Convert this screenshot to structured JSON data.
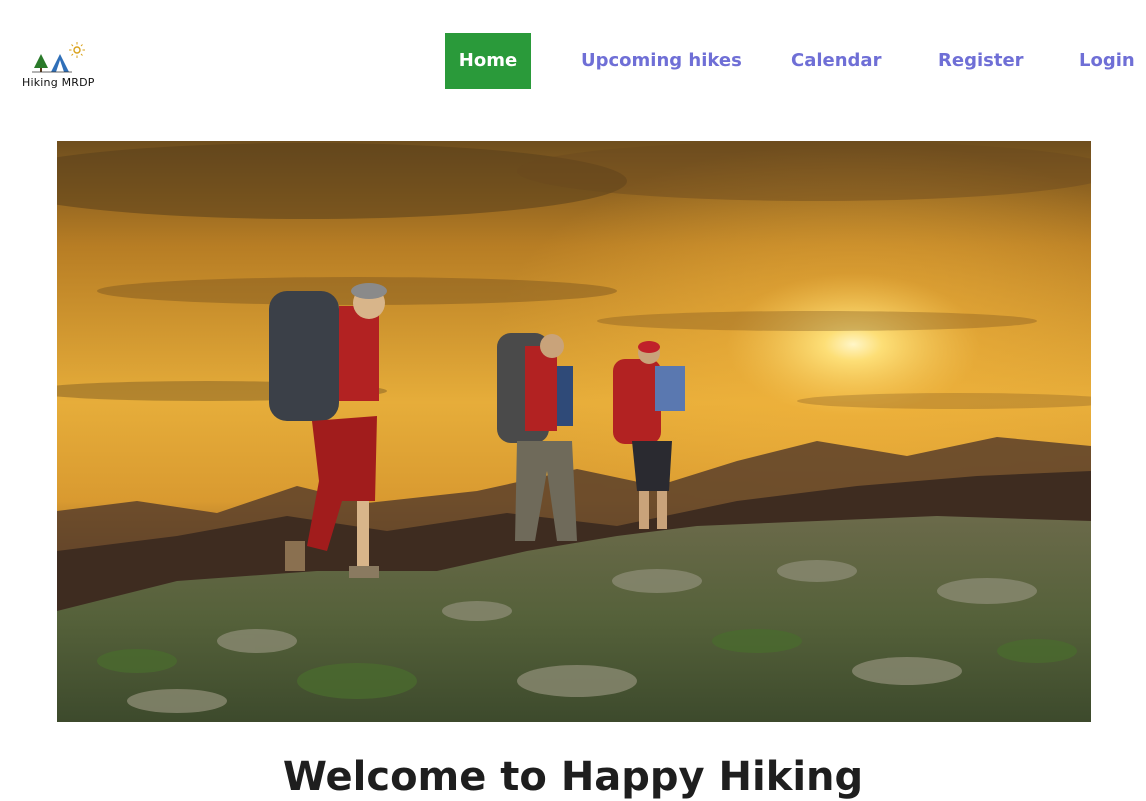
{
  "brand": {
    "logo_text": "Hiking MRDP"
  },
  "nav": {
    "items": [
      {
        "label": "Home",
        "active": true
      },
      {
        "label": "Upcoming hikes",
        "active": false
      },
      {
        "label": "Calendar",
        "active": false
      },
      {
        "label": "Register",
        "active": false
      },
      {
        "label": "Login",
        "active": false
      }
    ],
    "active_color": "#2a9a3a",
    "link_color": "#6f6fd6"
  },
  "hero": {
    "image_icon": "hikers-sunset-image"
  },
  "main": {
    "heading": "Welcome to Happy Hiking"
  }
}
